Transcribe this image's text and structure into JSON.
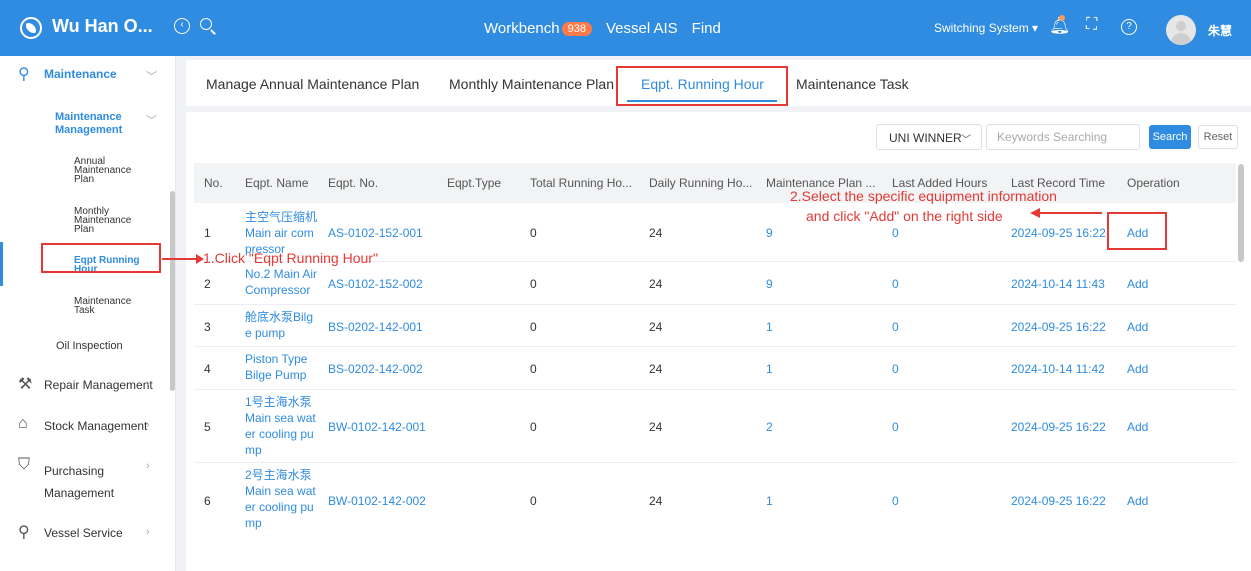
{
  "header": {
    "app_title": "Wu Han O...",
    "nav": [
      {
        "label": "Workbench",
        "badge": "938"
      },
      {
        "label": "Vessel AIS"
      },
      {
        "label": "Find"
      }
    ],
    "switching_system": "Switching System ▾",
    "user_name": "朱慧"
  },
  "sidebar": {
    "maintenance": "Maintenance",
    "maintenance_management": [
      "Maintenance",
      "Management"
    ],
    "sub_items": {
      "annual": [
        "Annual",
        "Maintenance",
        "Plan"
      ],
      "monthly": [
        "Monthly",
        "Maintenance",
        "Plan"
      ],
      "eqpt_running": [
        "Eqpt Running",
        "Hour"
      ],
      "maintenance_task": [
        "Maintenance",
        "Task"
      ]
    },
    "oil_inspection": "Oil Inspection",
    "repair_management": "Repair Management",
    "stock_management": "Stock Management",
    "purchasing": [
      "Purchasing",
      "Management"
    ],
    "vessel_service": "Vessel Service"
  },
  "tabs": [
    "Manage Annual Maintenance Plan",
    "Monthly Maintenance Plan",
    "Eqpt. Running Hour",
    "Maintenance Task"
  ],
  "filters": {
    "company_select": "UNI WINNER",
    "keywords_placeholder": "Keywords Searching",
    "search_label": "Search",
    "reset_label": "Reset"
  },
  "table": {
    "columns": [
      "No.",
      "Eqpt. Name",
      "Eqpt. No.",
      "Eqpt.Type",
      "Total Running Ho...",
      "Daily Running Ho...",
      "Maintenance Plan ...",
      "Last Added Hours",
      "Last Record Time",
      "Operation"
    ],
    "rows": [
      {
        "no": "1",
        "name": [
          "主空气压缩机",
          "Main air com",
          "pressor"
        ],
        "eqpt_no": "AS-0102-152-001",
        "type": "",
        "total": "0",
        "daily": "24",
        "plan": "9",
        "last_added": "0",
        "last_time": "2024-09-25 16:22",
        "op": "Add"
      },
      {
        "no": "2",
        "name": [
          "No.2 Main Air",
          "Compressor"
        ],
        "eqpt_no": "AS-0102-152-002",
        "type": "",
        "total": "0",
        "daily": "24",
        "plan": "9",
        "last_added": "0",
        "last_time": "2024-10-14 11:43",
        "op": "Add"
      },
      {
        "no": "3",
        "name": [
          "舱底水泵Bilg",
          "e pump"
        ],
        "eqpt_no": "BS-0202-142-001",
        "type": "",
        "total": "0",
        "daily": "24",
        "plan": "1",
        "last_added": "0",
        "last_time": "2024-09-25 16:22",
        "op": "Add"
      },
      {
        "no": "4",
        "name": [
          "Piston Type",
          "Bilge Pump"
        ],
        "eqpt_no": "BS-0202-142-002",
        "type": "",
        "total": "0",
        "daily": "24",
        "plan": "1",
        "last_added": "0",
        "last_time": "2024-10-14 11:42",
        "op": "Add"
      },
      {
        "no": "5",
        "name": [
          "1号主海水泵",
          "Main sea wat",
          "er cooling pu",
          "mp"
        ],
        "eqpt_no": "BW-0102-142-001",
        "type": "",
        "total": "0",
        "daily": "24",
        "plan": "2",
        "last_added": "0",
        "last_time": "2024-09-25 16:22",
        "op": "Add"
      },
      {
        "no": "6",
        "name": [
          "2号主海水泵",
          "Main sea wat",
          "er cooling pu",
          "mp"
        ],
        "eqpt_no": "BW-0102-142-002",
        "type": "",
        "total": "0",
        "daily": "24",
        "plan": "1",
        "last_added": "0",
        "last_time": "2024-09-25 16:22",
        "op": "Add"
      }
    ]
  },
  "annotations": {
    "step1": "1.Click \"Eqpt Running Hour\"",
    "step2_line1": "2.Select the specific equipment information",
    "step2_line2": "and click \"Add\" on the right side"
  },
  "colors": {
    "primary": "#2f8ce0",
    "annotation": "#e53935",
    "badge": "#ff7a4a"
  }
}
